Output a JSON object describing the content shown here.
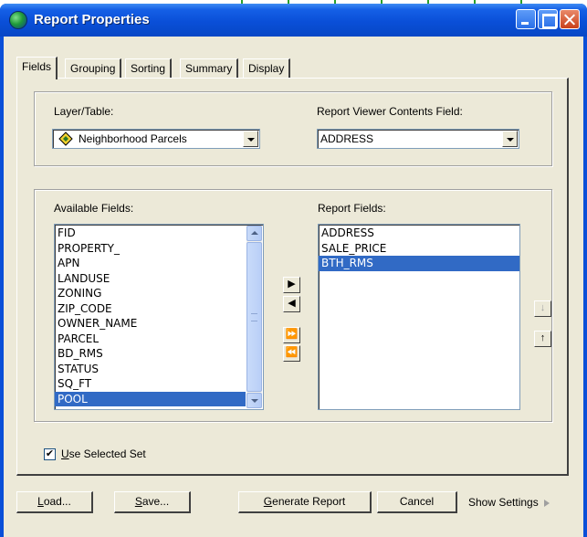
{
  "window": {
    "title": "Report Properties",
    "title_icon": "globe-icon"
  },
  "tabs": [
    {
      "label": "Fields",
      "active": true
    },
    {
      "label": "Grouping",
      "active": false
    },
    {
      "label": "Sorting",
      "active": false
    },
    {
      "label": "Summary",
      "active": false
    },
    {
      "label": "Display",
      "active": false
    }
  ],
  "layer": {
    "label": "Layer/Table:",
    "value": "Neighborhood Parcels",
    "icon": "layer-diamond-icon"
  },
  "contents_field": {
    "label": "Report Viewer Contents Field:",
    "value": "ADDRESS"
  },
  "available": {
    "label": "Available Fields:",
    "items": [
      "FID",
      "PROPERTY_",
      "APN",
      "LANDUSE",
      "ZONING",
      "ZIP_CODE",
      "OWNER_NAME",
      "PARCEL",
      "BD_RMS",
      "STATUS",
      "SQ_FT",
      "POOL"
    ],
    "selected": "POOL"
  },
  "report": {
    "label": "Report Fields:",
    "items": [
      "ADDRESS",
      "SALE_PRICE",
      "BTH_RMS"
    ],
    "selected": "BTH_RMS"
  },
  "transfer_buttons": {
    "add": "▶",
    "remove": "◀",
    "add_all": "⏩",
    "remove_all": "⏪"
  },
  "order_buttons": {
    "down": "↓",
    "up": "↑"
  },
  "use_selected": {
    "prefix": "",
    "accel": "U",
    "rest": "se Selected Set",
    "checked": true
  },
  "buttons": {
    "load": {
      "accel": "L",
      "rest": "oad..."
    },
    "save": {
      "accel": "S",
      "rest": "ave..."
    },
    "generate": {
      "accel": "G",
      "rest": "enerate Report"
    },
    "cancel": "Cancel",
    "show_settings": "Show Settings"
  },
  "colors": {
    "titlebar": "#0a4fd8",
    "selection": "#316ac5",
    "dialog_bg": "#ece9d8"
  }
}
